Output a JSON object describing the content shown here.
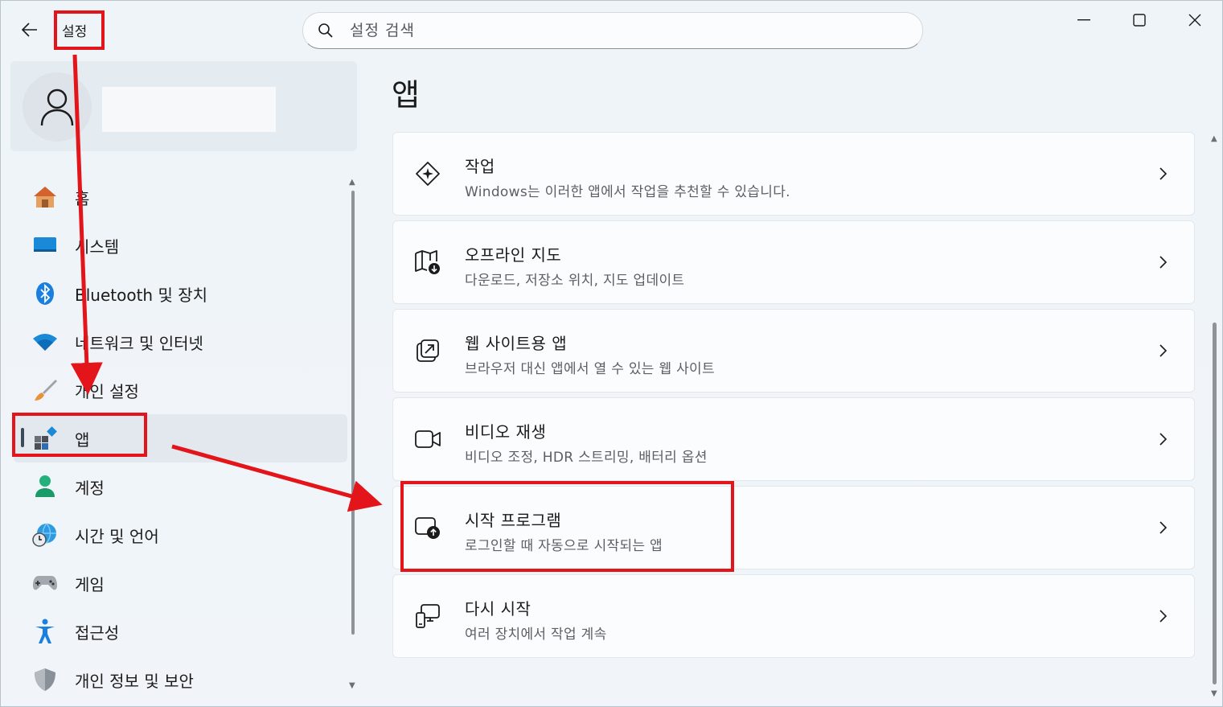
{
  "window": {
    "title": "설정",
    "search_placeholder": "설정 검색"
  },
  "sidebar": {
    "items": [
      {
        "label": "홈",
        "icon": "home-icon"
      },
      {
        "label": "시스템",
        "icon": "system-icon"
      },
      {
        "label": "Bluetooth 및 장치",
        "icon": "bluetooth-icon"
      },
      {
        "label": "네트워크 및 인터넷",
        "icon": "wifi-icon"
      },
      {
        "label": "개인 설정",
        "icon": "brush-icon"
      },
      {
        "label": "앱",
        "icon": "apps-icon",
        "selected": true
      },
      {
        "label": "계정",
        "icon": "account-icon"
      },
      {
        "label": "시간 및 언어",
        "icon": "globe-clock-icon"
      },
      {
        "label": "게임",
        "icon": "gamepad-icon"
      },
      {
        "label": "접근성",
        "icon": "accessibility-icon"
      },
      {
        "label": "개인 정보 및 보안",
        "icon": "shield-icon"
      }
    ]
  },
  "main": {
    "title": "앱",
    "cards": [
      {
        "title": "작업",
        "subtitle": "Windows는 이러한 앱에서 작업을 추천할 수 있습니다.",
        "icon": "actions-icon"
      },
      {
        "title": "오프라인 지도",
        "subtitle": "다운로드, 저장소 위치, 지도 업데이트",
        "icon": "offline-map-icon"
      },
      {
        "title": "웹 사이트용 앱",
        "subtitle": "브라우저 대신 앱에서 열 수 있는 웹 사이트",
        "icon": "open-external-icon"
      },
      {
        "title": "비디오 재생",
        "subtitle": "비디오 조정, HDR 스트리밍, 배터리 옵션",
        "icon": "video-camera-icon"
      },
      {
        "title": "시작 프로그램",
        "subtitle": "로그인할 때 자동으로 시작되는 앱",
        "icon": "startup-icon"
      },
      {
        "title": "다시 시작",
        "subtitle": "여러 장치에서 작업 계속",
        "icon": "resume-devices-icon"
      }
    ]
  },
  "colors": {
    "annotation_red": "#e3151a",
    "accent": "#0067c0"
  }
}
